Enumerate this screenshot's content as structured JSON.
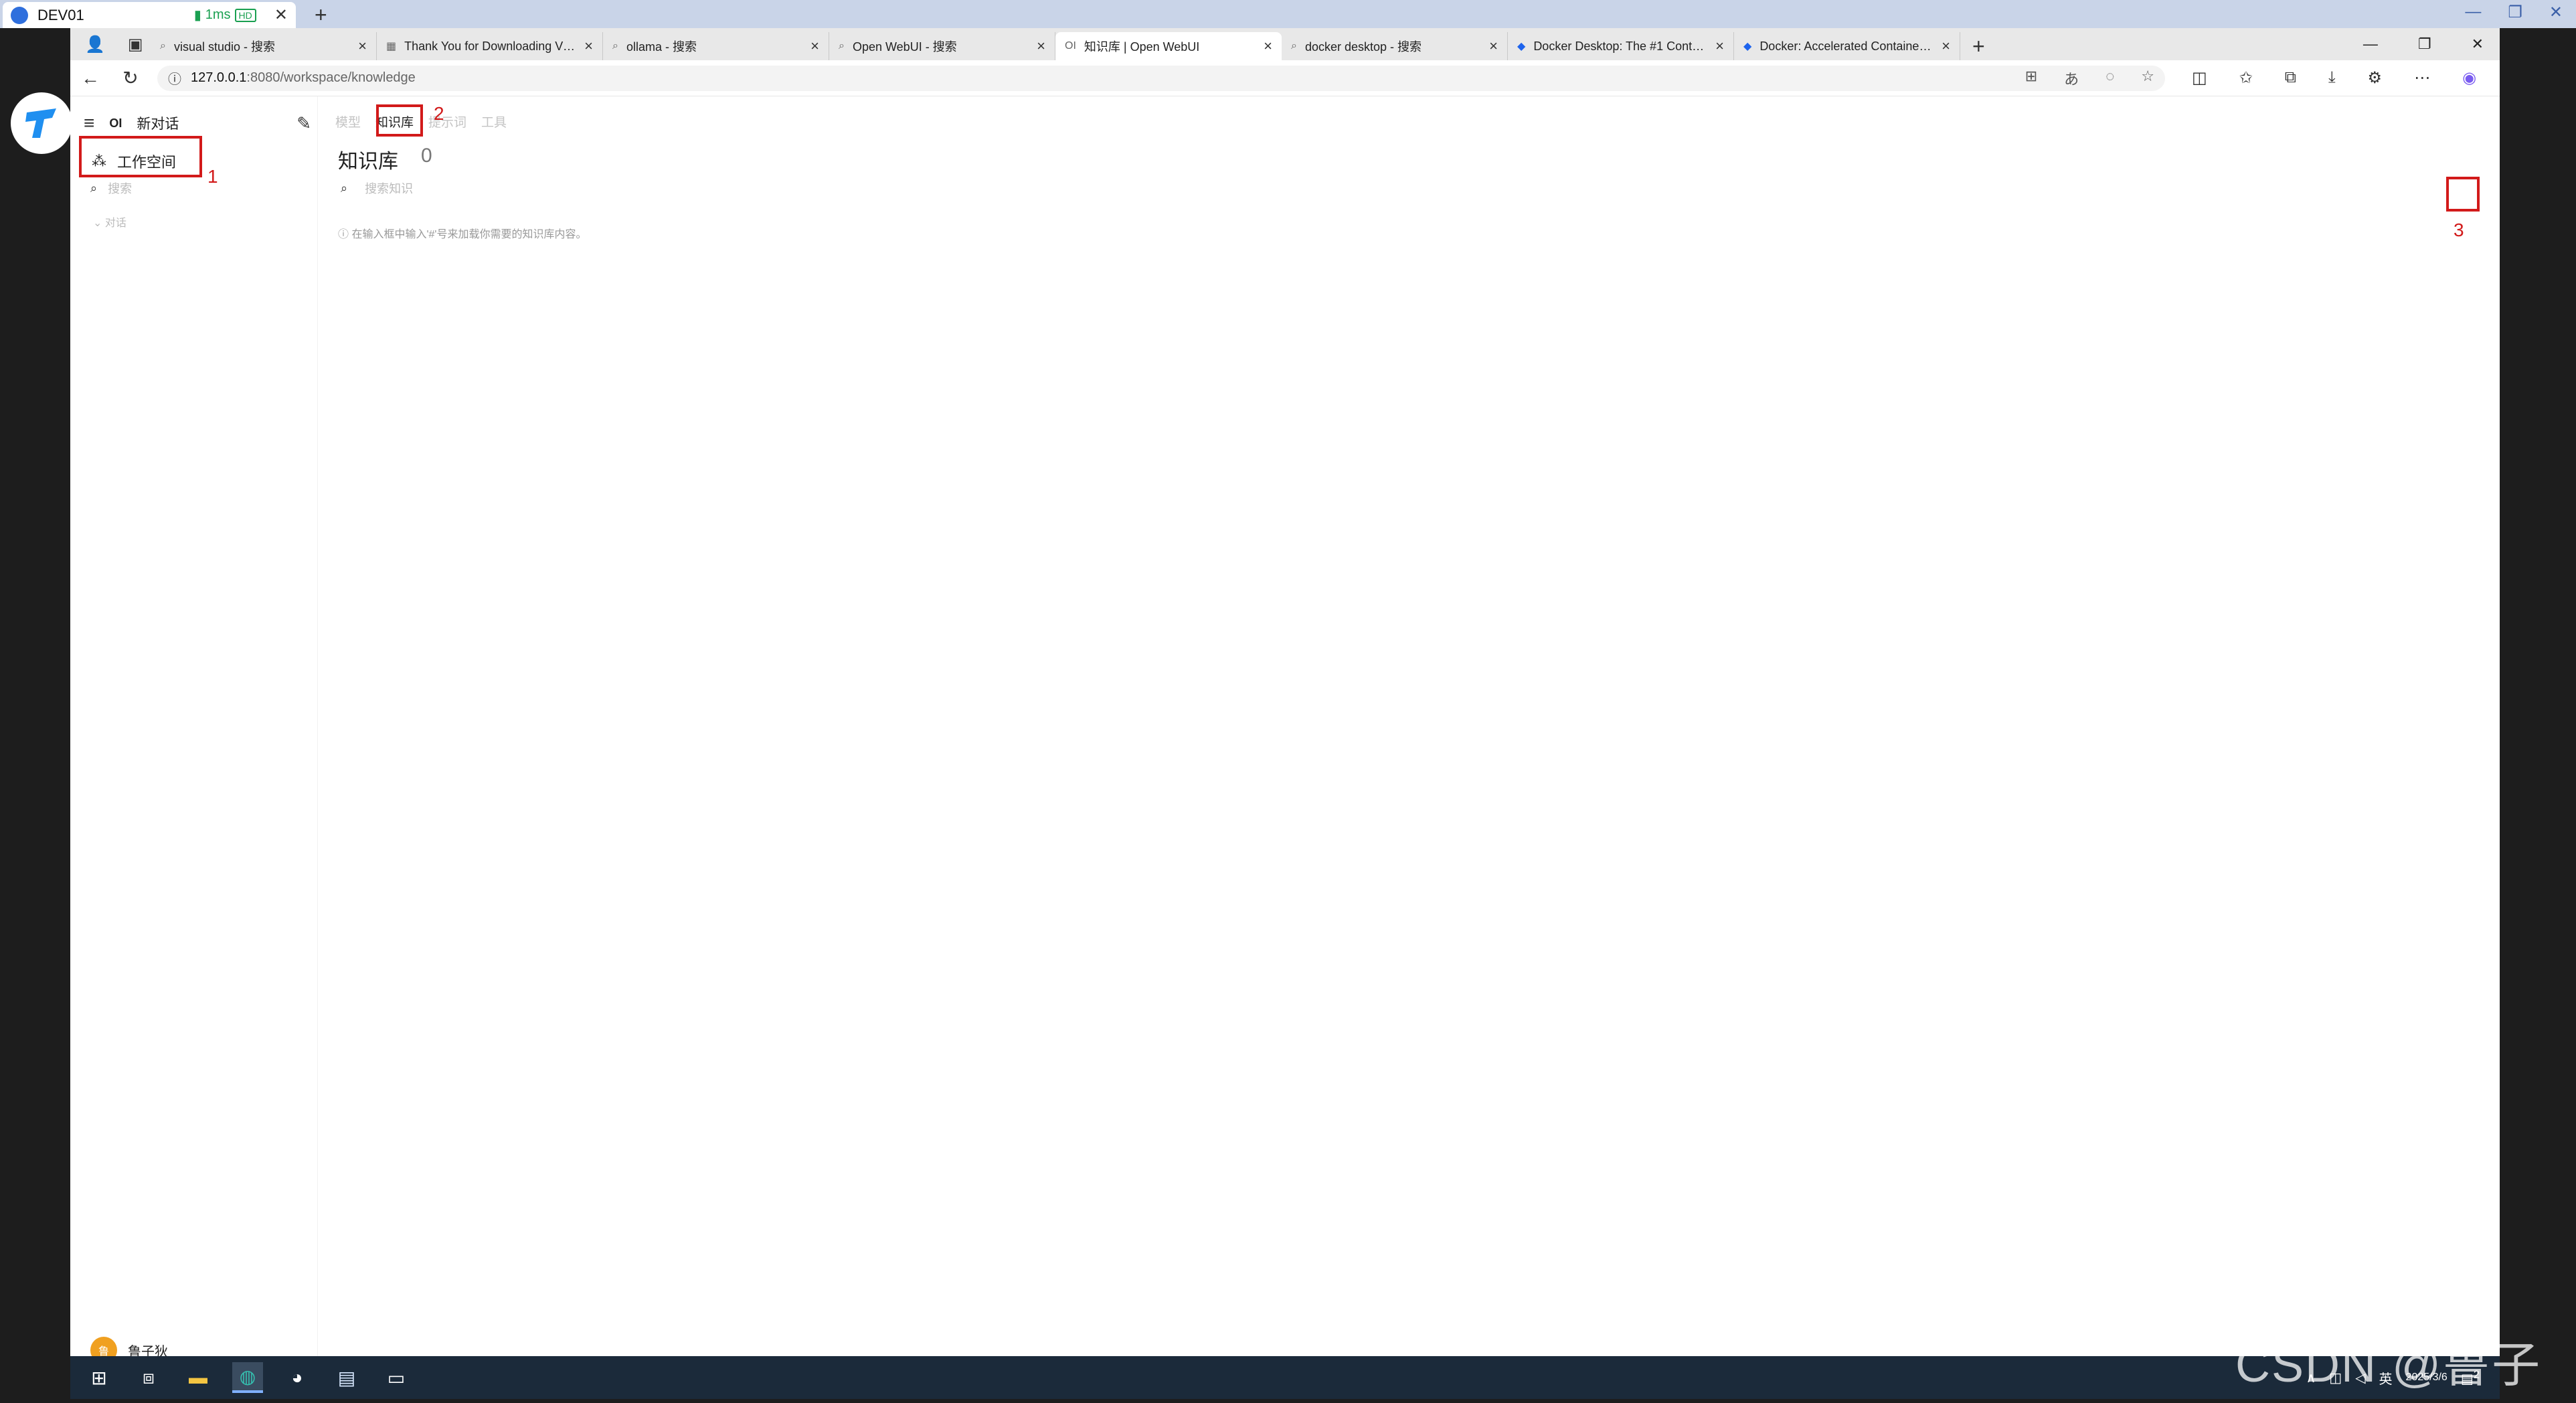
{
  "remote_desktop": {
    "title": "DEV01",
    "latency": "1ms",
    "quality": "HD"
  },
  "browser": {
    "tabs": [
      {
        "label": "visual studio - 搜索",
        "icon": "search-icon"
      },
      {
        "label": "Thank You for Downloading Visu",
        "icon": "ms-icon"
      },
      {
        "label": "ollama - 搜索",
        "icon": "search-icon"
      },
      {
        "label": "Open WebUI - 搜索",
        "icon": "search-icon"
      },
      {
        "label": "知识库 | Open WebUI",
        "icon": "oi-icon",
        "active": true
      },
      {
        "label": "docker desktop - 搜索",
        "icon": "search-icon"
      },
      {
        "label": "Docker Desktop: The #1 Contain",
        "icon": "docker-icon"
      },
      {
        "label": "Docker: Accelerated Container A",
        "icon": "docker-icon"
      }
    ],
    "url_host": "127.0.0.1",
    "url_path": ":8080/workspace/knowledge"
  },
  "sidebar": {
    "logo": "OI",
    "new_chat": "新对话",
    "workspace": "工作空间",
    "search_placeholder": "搜索",
    "section": "对话",
    "user_name": "鲁子狄",
    "user_initial": "鲁"
  },
  "workspace": {
    "tabs": [
      "模型",
      "知识库",
      "提示词",
      "工具"
    ],
    "active_tab": 1,
    "title": "知识库",
    "count": "0",
    "search_placeholder": "搜索知识",
    "hint": "ⓘ 在输入框中输入'#'号来加载你需要的知识库内容。"
  },
  "annotations": [
    "1",
    "2",
    "3"
  ],
  "taskbar": {
    "lang": "英",
    "date": "2025/3/6",
    "notif": "2"
  },
  "watermark": "CSDN @鲁子狄"
}
